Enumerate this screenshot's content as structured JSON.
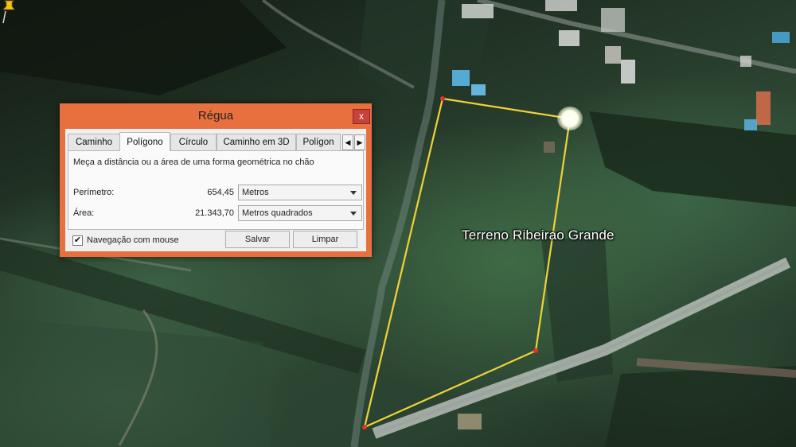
{
  "dialog": {
    "title": "Régua",
    "close_glyph": "x",
    "tabs": [
      {
        "label": "Caminho",
        "active": false
      },
      {
        "label": "Polígono",
        "active": true
      },
      {
        "label": "Círculo",
        "active": false
      },
      {
        "label": "Caminho em 3D",
        "active": false
      },
      {
        "label": "Polígon",
        "active": false
      }
    ],
    "tab_scroll_left": "◀",
    "tab_scroll_right": "▶",
    "description": "Meça a distância ou a área de uma forma geométrica no chão",
    "perimeter": {
      "label": "Perímetro:",
      "value": "654,45",
      "unit": "Metros"
    },
    "area": {
      "label": "Área:",
      "value": "21.343,70",
      "unit": "Metros quadrados"
    },
    "mouse_navigation": {
      "label": "Navegação com mouse",
      "checked": true,
      "mark": "✔"
    },
    "save_button": "Salvar",
    "clear_button": "Limpar"
  },
  "map": {
    "placemark_label": "Terreno Ribeirao Grande",
    "polygon_color": "#f1d23b",
    "vertex_color": "#e0322b"
  }
}
